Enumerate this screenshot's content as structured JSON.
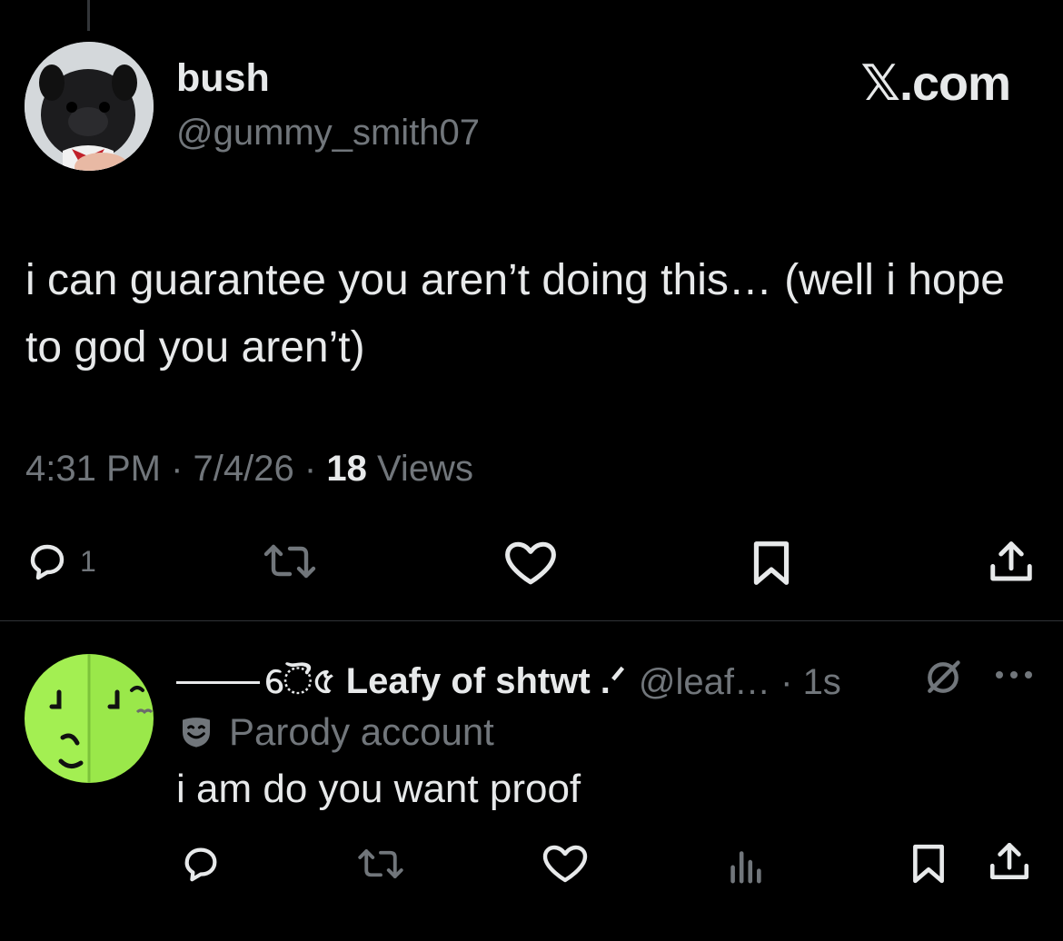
{
  "tweet": {
    "author": {
      "display_name": "bush",
      "handle": "@gummy_smith07"
    },
    "brand": "𝕏.com",
    "text": "i can guarantee you aren’t doing this… (well i hope to god you aren’t)",
    "time": "4:31 PM",
    "date": "7/4/26",
    "views_count": "18",
    "views_label": "Views",
    "separator": "·",
    "reply_count": "1",
    "icons": [
      "reply-icon",
      "retweet-icon",
      "like-icon",
      "bookmark-icon",
      "share-icon"
    ]
  },
  "reply": {
    "display_name": "ୈ৫ Leafy of shtwt .ᐟ",
    "handle": "@leaf…",
    "time_ago": "1s",
    "parody_label": "Parody account",
    "text": "i am do you want proof",
    "icons": [
      "reply-icon",
      "retweet-icon",
      "like-icon",
      "views-icon",
      "bookmark-icon",
      "share-icon",
      "grok-icon",
      "more-icon",
      "parody-mask-icon"
    ]
  },
  "colors": {
    "background": "#000000",
    "primary_text": "#e7e9ea",
    "secondary_text": "#71767b",
    "divider": "#2f3336",
    "avatar_green": "#a3ef52"
  }
}
